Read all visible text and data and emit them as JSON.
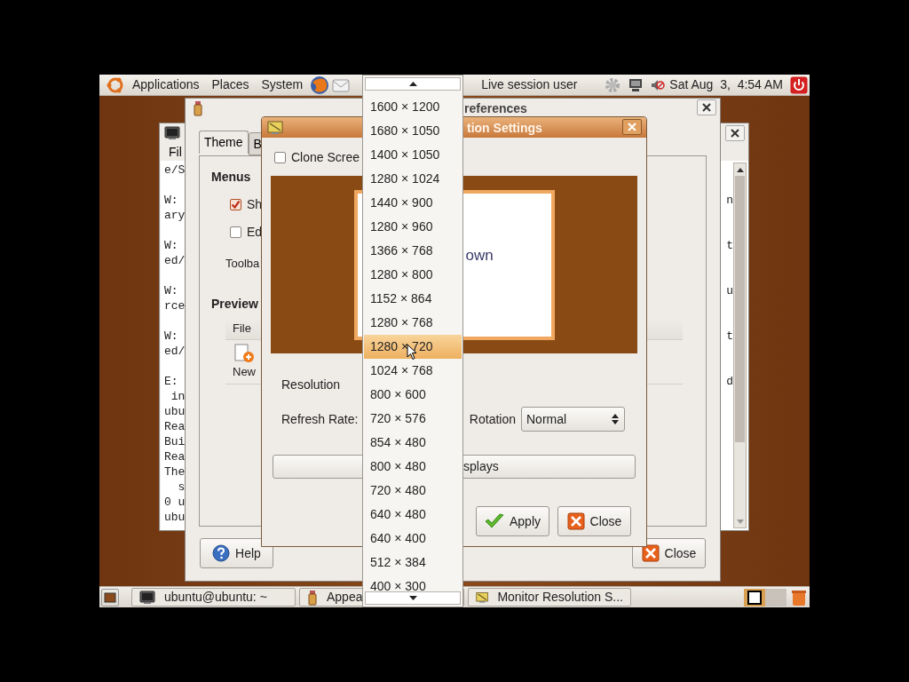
{
  "top_panel": {
    "menus": [
      {
        "label": "Applications"
      },
      {
        "label": "Places"
      },
      {
        "label": "System"
      }
    ],
    "user": "Live session user",
    "clock": "Sat Aug  3,  4:54 AM"
  },
  "terminal": {
    "menu": "Fil",
    "blocks": [
      [
        {
          "text": "e/S"
        }
      ],
      [
        {
          "text": "W:",
          "end": "n"
        },
        {
          "text": "ary"
        }
      ],
      [
        {
          "text": "W:",
          "end": "t"
        },
        {
          "text": "ed/"
        }
      ],
      [
        {
          "text": "W:",
          "end": "u"
        },
        {
          "text": "rce"
        }
      ],
      [
        {
          "text": "W:",
          "end": "t"
        },
        {
          "text": "ed/"
        }
      ],
      [
        {
          "text": "E:",
          "end": "d"
        },
        {
          "text": " in"
        },
        {
          "text": "ubu"
        },
        {
          "text": "Rea"
        },
        {
          "text": "Bui"
        },
        {
          "text": "Rea"
        },
        {
          "text": "The"
        },
        {
          "text": "  s"
        },
        {
          "text": "0 u"
        },
        {
          "text": "ubu"
        }
      ]
    ]
  },
  "appearance": {
    "title": "references",
    "tabs": [
      {
        "label": "Theme",
        "selected": true
      },
      {
        "label": "B",
        "selected": false
      }
    ],
    "menus_heading": "Menus",
    "options": [
      {
        "label": "Sh",
        "checked": true
      },
      {
        "label": "Ed",
        "checked": false
      }
    ],
    "toolbar_label": "Toolba",
    "preview_heading": "Preview",
    "preview_menu": "File",
    "preview_tool": "New",
    "buttons": [
      {
        "label": "Help",
        "kind": "help"
      },
      {
        "label": "Close",
        "kind": "close"
      }
    ]
  },
  "monitor_dialog": {
    "title": "tion Settings",
    "clone": {
      "label": "Clone Scree",
      "checked": false
    },
    "preview_text": "own",
    "resolution_label": "Resolution",
    "refresh_label": "Refresh Rate:",
    "rotation_label": "Rotation",
    "rotation_value": "Normal",
    "detect_button": "splays",
    "buttons": [
      {
        "label": "Apply",
        "kind": "apply"
      },
      {
        "label": "Close",
        "kind": "close"
      }
    ]
  },
  "dropdown": {
    "items": [
      {
        "label": "1600 × 1200",
        "selected": false
      },
      {
        "label": "1680 × 1050",
        "selected": false
      },
      {
        "label": "1400 × 1050",
        "selected": false
      },
      {
        "label": "1280 × 1024",
        "selected": false
      },
      {
        "label": "1440 × 900",
        "selected": false
      },
      {
        "label": "1280 × 960",
        "selected": false
      },
      {
        "label": "1366 × 768",
        "selected": false
      },
      {
        "label": "1280 × 800",
        "selected": false
      },
      {
        "label": "1152 × 864",
        "selected": false
      },
      {
        "label": "1280 × 768",
        "selected": false
      },
      {
        "label": "1280 × 720",
        "selected": true
      },
      {
        "label": "1024 × 768",
        "selected": false
      },
      {
        "label": "800 × 600",
        "selected": false
      },
      {
        "label": "720 × 576",
        "selected": false
      },
      {
        "label": "854 × 480",
        "selected": false
      },
      {
        "label": "800 × 480",
        "selected": false
      },
      {
        "label": "720 × 480",
        "selected": false
      },
      {
        "label": "640 × 480",
        "selected": false
      },
      {
        "label": "640 × 400",
        "selected": false
      },
      {
        "label": "512 × 384",
        "selected": false
      },
      {
        "label": "400 × 300",
        "selected": false
      }
    ]
  },
  "taskbar": {
    "items": [
      {
        "label": "ubuntu@ubuntu: ~",
        "kind": "terminal"
      },
      {
        "label": "Appea",
        "kind": "appearance"
      },
      {
        "label": "Monitor Resolution S...",
        "kind": "monitor"
      }
    ]
  }
}
